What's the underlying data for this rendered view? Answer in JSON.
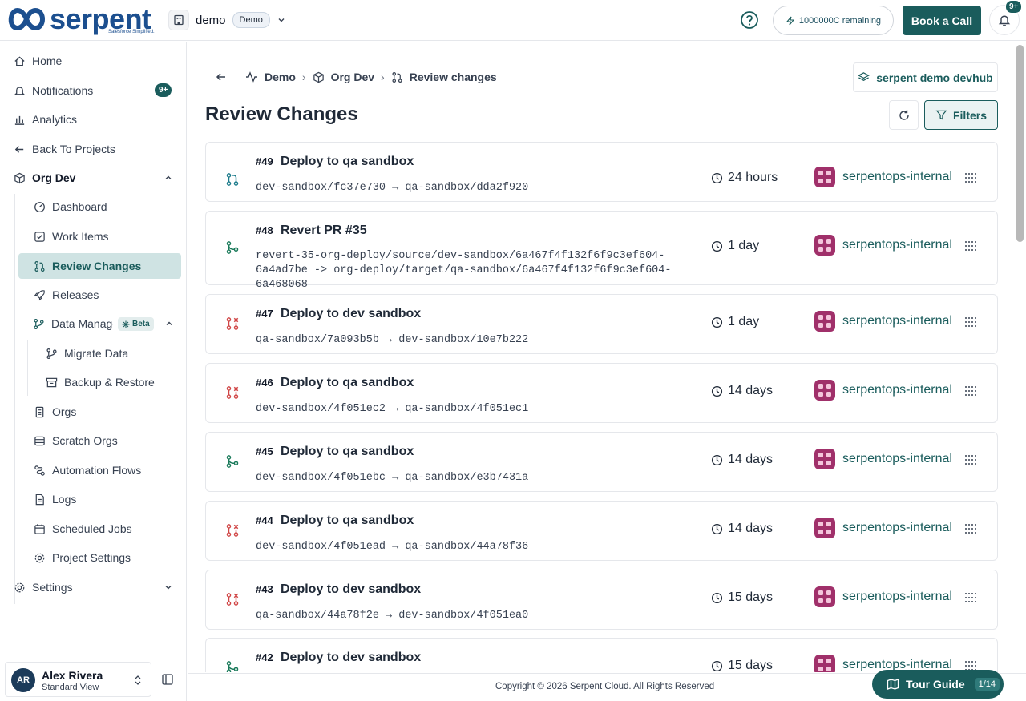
{
  "topbar": {
    "logo_text": "serpent",
    "logo_tagline": "Salesforce Simplified.",
    "workspace_name": "demo",
    "workspace_badge": "Demo",
    "credits": "1000000C remaining",
    "book_call": "Book a Call",
    "notification_count": "9+"
  },
  "sidebar": {
    "items": [
      {
        "label": "Home",
        "icon": "home-icon"
      },
      {
        "label": "Notifications",
        "icon": "bell-icon",
        "badge": "9+"
      },
      {
        "label": "Analytics",
        "icon": "bar-chart-icon"
      },
      {
        "label": "Back To Projects",
        "icon": "arrow-left-icon"
      },
      {
        "label": "Org Dev",
        "icon": "cube-icon"
      }
    ],
    "org_items": [
      {
        "label": "Dashboard",
        "icon": "gauge-icon"
      },
      {
        "label": "Work Items",
        "icon": "checkbox-icon"
      },
      {
        "label": "Review Changes",
        "icon": "git-pull-request-icon"
      },
      {
        "label": "Releases",
        "icon": "rocket-icon"
      },
      {
        "label": "Data Management",
        "icon": "git-branch-icon",
        "badge": "Beta"
      },
      {
        "label": "Orgs",
        "icon": "box-icon"
      },
      {
        "label": "Scratch Orgs",
        "icon": "database-icon"
      },
      {
        "label": "Automation Flows",
        "icon": "workflow-icon"
      },
      {
        "label": "Logs",
        "icon": "file-icon"
      },
      {
        "label": "Scheduled Jobs",
        "icon": "calendar-icon"
      },
      {
        "label": "Project Settings",
        "icon": "gear-icon"
      }
    ],
    "data_items": [
      {
        "label": "Migrate Data",
        "icon": "git-branch-icon"
      },
      {
        "label": "Backup & Restore",
        "icon": "archive-icon"
      }
    ],
    "settings": "Settings",
    "user": {
      "initials": "AR",
      "name": "Alex Rivera",
      "view": "Standard View"
    }
  },
  "main": {
    "breadcrumb": [
      "Demo",
      "Org Dev",
      "Review changes"
    ],
    "devhub": "serpent demo devhub",
    "title": "Review Changes",
    "filters": "Filters",
    "reviews": [
      {
        "num": "#49",
        "title": "Deploy to qa sandbox",
        "branch": "dev-sandbox/fc37e730 → qa-sandbox/dda2f920",
        "time": "24 hours",
        "org": "serpentops-internal",
        "status": "open"
      },
      {
        "num": "#48",
        "title": "Revert PR #35",
        "branch": "revert-35-org-deploy/source/dev-sandbox/6a467f4f132f6f9c3ef604-6a4ad7be -> org-deploy/target/qa-sandbox/6a467f4f132f6f9c3ef604-6a468068",
        "time": "1 day",
        "org": "serpentops-internal",
        "status": "merged"
      },
      {
        "num": "#47",
        "title": "Deploy to dev sandbox",
        "branch": "qa-sandbox/7a093b5b → dev-sandbox/10e7b222",
        "time": "1 day",
        "org": "serpentops-internal",
        "status": "closed"
      },
      {
        "num": "#46",
        "title": "Deploy to qa sandbox",
        "branch": "dev-sandbox/4f051ec2 → qa-sandbox/4f051ec1",
        "time": "14 days",
        "org": "serpentops-internal",
        "status": "closed"
      },
      {
        "num": "#45",
        "title": "Deploy to qa sandbox",
        "branch": "dev-sandbox/4f051ebc → qa-sandbox/e3b7431a",
        "time": "14 days",
        "org": "serpentops-internal",
        "status": "merged"
      },
      {
        "num": "#44",
        "title": "Deploy to qa sandbox",
        "branch": "dev-sandbox/4f051ead → qa-sandbox/44a78f36",
        "time": "14 days",
        "org": "serpentops-internal",
        "status": "closed"
      },
      {
        "num": "#43",
        "title": "Deploy to dev sandbox",
        "branch": "qa-sandbox/44a78f2e → dev-sandbox/4f051ea0",
        "time": "15 days",
        "org": "serpentops-internal",
        "status": "closed"
      },
      {
        "num": "#42",
        "title": "Deploy to dev sandbox",
        "branch": "",
        "time": "15 days",
        "org": "serpentops-internal",
        "status": "merged"
      }
    ]
  },
  "footer": {
    "copyright": "Copyright © 2026 Serpent Cloud. All Rights Reserved",
    "tour_label": "Tour Guide",
    "tour_count": "1/14"
  },
  "colors": {
    "brand": "#1a5c5c",
    "logo": "#1c4f8f",
    "open": "#1a7a8a",
    "merged": "#1a7a5a",
    "closed": "#d04545",
    "org_logo": "#a0306a"
  }
}
